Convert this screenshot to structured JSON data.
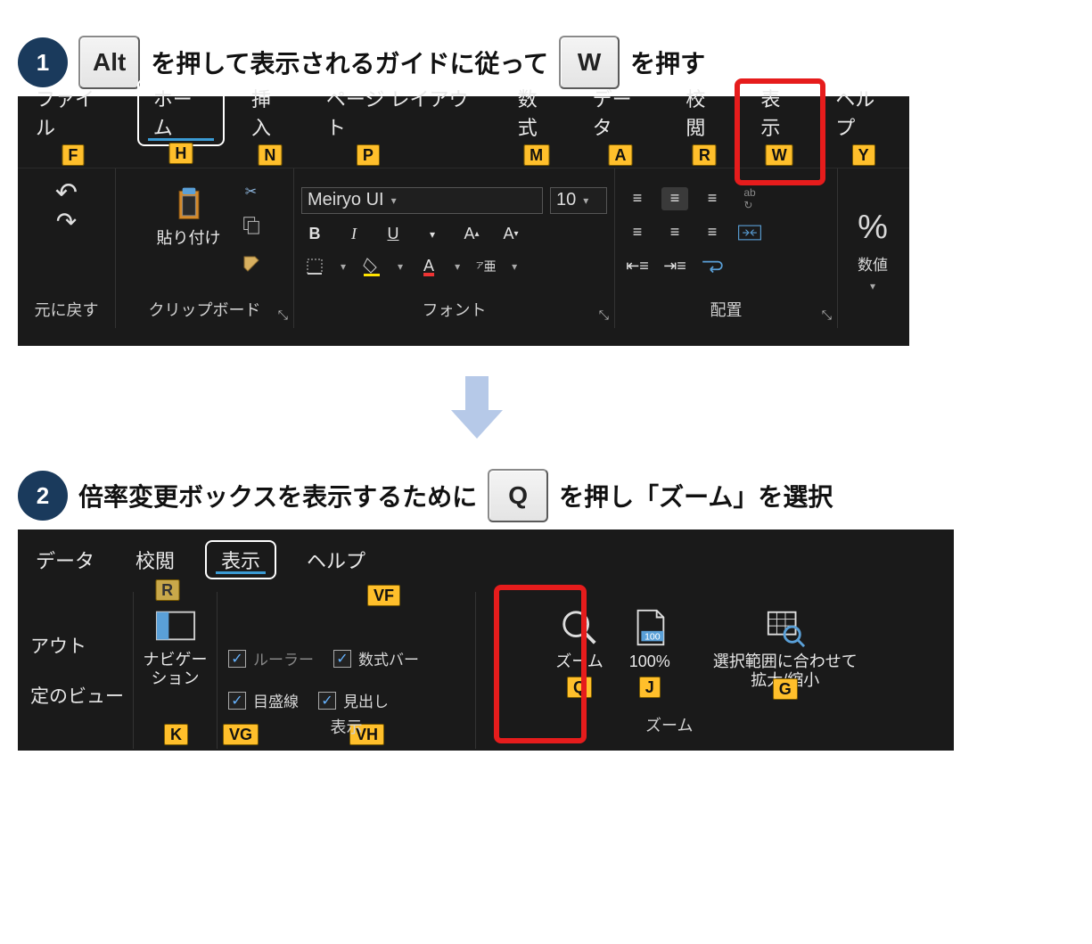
{
  "step1": {
    "num": "1",
    "key1": "Alt",
    "text1": "を押して表示されるガイドに従って",
    "key2": "W",
    "text2": "を押す"
  },
  "ribbon1": {
    "tabs": [
      {
        "label": "ファイル",
        "tip": "F"
      },
      {
        "label": "ホーム",
        "tip": "H",
        "active": true
      },
      {
        "label": "挿入",
        "tip": "N"
      },
      {
        "label": "ページ レイアウト",
        "tip": "P"
      },
      {
        "label": "数式",
        "tip": "M"
      },
      {
        "label": "データ",
        "tip": "A"
      },
      {
        "label": "校閲",
        "tip": "R"
      },
      {
        "label": "表示",
        "tip": "W"
      },
      {
        "label": "ヘルプ",
        "tip": "Y"
      }
    ],
    "font_name": "Meiryo UI",
    "font_size": "10",
    "groups": {
      "undo": "元に戻す",
      "clipboard": "クリップボード",
      "paste": "貼り付け",
      "font": "フォント",
      "alignment": "配置",
      "number": "数値"
    },
    "buttons": {
      "bold": "B",
      "italic": "I",
      "underline": "U",
      "percent": "%"
    }
  },
  "step2": {
    "num": "2",
    "text1": "倍率変更ボックスを表示するために",
    "key1": "Q",
    "text2": "を押し「ズーム」を選択"
  },
  "ribbon2": {
    "tabs": [
      {
        "label": "データ"
      },
      {
        "label": "校閲",
        "tip": "R"
      },
      {
        "label": "表示",
        "active": true
      },
      {
        "label": "ヘルプ"
      }
    ],
    "left_stubs": {
      "a": "アウト",
      "b": "定のビュー"
    },
    "nav": {
      "label": "ナビゲー\nション",
      "tip": "K"
    },
    "show_group": {
      "ruler": "ルーラー",
      "ruler_tip": "VF",
      "gridlines": "目盛線",
      "gridlines_tip": "VG",
      "formulabar": "数式バー",
      "headings": "見出し",
      "headings_tip": "VH",
      "label": "表示"
    },
    "zoom": {
      "label": "ズーム",
      "tip": "Q"
    },
    "hundred": {
      "label": "100%",
      "tip": "J"
    },
    "fit": {
      "label": "選択範囲に合わせて\n拡大/縮小",
      "tip": "G"
    },
    "zoom_group": "ズーム"
  }
}
